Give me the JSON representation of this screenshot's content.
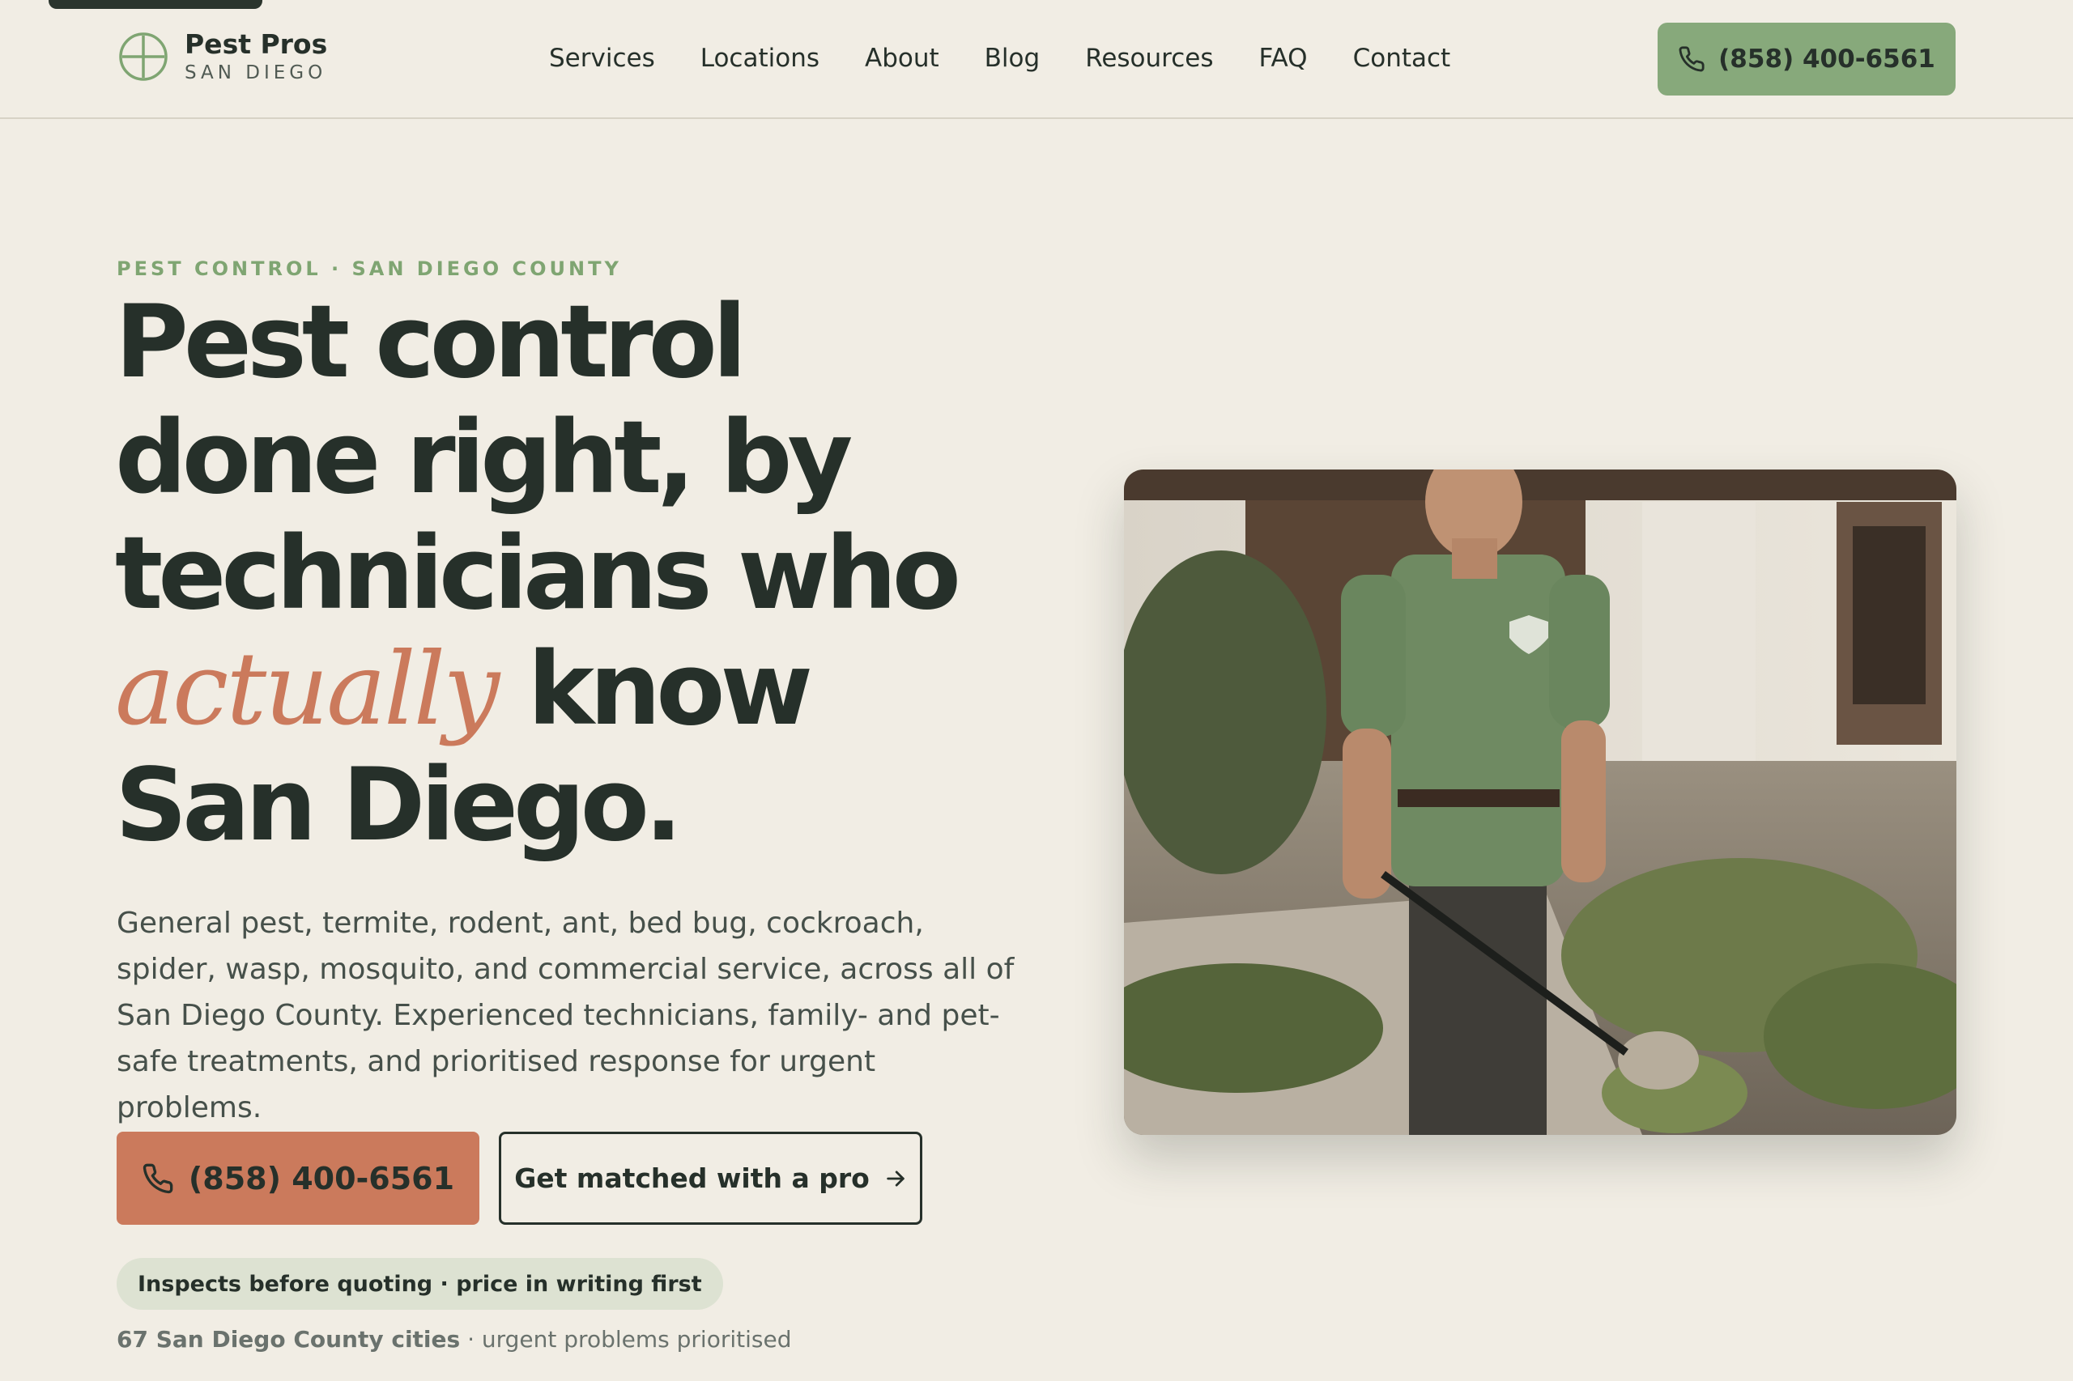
{
  "brand": {
    "name": "Pest Pros",
    "sub": "SAN DIEGO"
  },
  "nav": {
    "items": [
      "Services",
      "Locations",
      "About",
      "Blog",
      "Resources",
      "FAQ",
      "Contact"
    ],
    "phone": "(858) 400-6561"
  },
  "hero": {
    "eyebrow": "PEST CONTROL · SAN DIEGO COUNTY",
    "headline_part1": "Pest control done right, by technicians who",
    "headline_em": "actually",
    "headline_part2": "know San Diego.",
    "description": "General pest, termite, rodent, ant, bed bug, cockroach, spider, wasp, mosquito, and commercial service, across all of San Diego County. Experienced technicians, family- and pet-safe treatments, and prioritised response for urgent problems.",
    "cta_call": "(858) 400-6561",
    "cta_match": "Get matched with a pro",
    "badge": "Inspects before quoting · price in writing first",
    "meta_bold": "67 San Diego County cities",
    "meta_rest": "· urgent problems prioritised"
  },
  "colors": {
    "accent_green": "#87a97b",
    "accent_terracotta": "#cb7a5c",
    "ink": "#26302a",
    "background": "#f1ede4"
  },
  "icons": {
    "logo": "circle-cross-icon",
    "phone": "phone-icon",
    "arrow": "arrow-right-icon"
  }
}
